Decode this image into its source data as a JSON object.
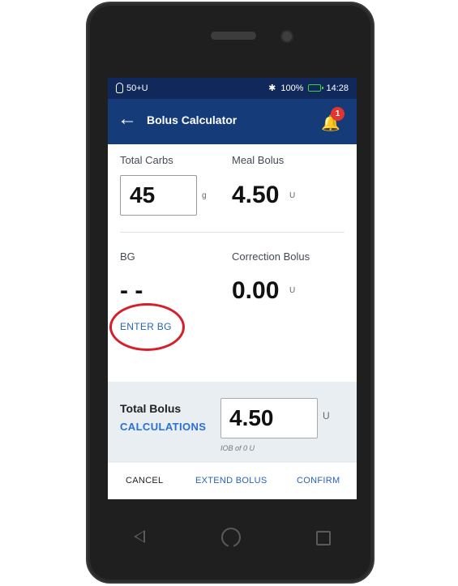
{
  "status_bar": {
    "insulin_reading": "50+U",
    "battery_percent": "100%",
    "time": "14:28"
  },
  "app_bar": {
    "title": "Bolus Calculator",
    "notification_count": "1"
  },
  "carbs": {
    "label": "Total Carbs",
    "value": "45",
    "unit": "g"
  },
  "meal_bolus": {
    "label": "Meal Bolus",
    "value": "4.50",
    "unit": "U"
  },
  "bg": {
    "label": "BG",
    "value": "- -",
    "enter_label": "ENTER BG"
  },
  "correction_bolus": {
    "label": "Correction Bolus",
    "value": "0.00",
    "unit": "U"
  },
  "total_bolus": {
    "label": "Total Bolus",
    "calculations_label": "CALCULATIONS",
    "value": "4.50",
    "unit": "U",
    "iob_note": "IOB of 0 U"
  },
  "actions": {
    "cancel": "CANCEL",
    "extend": "EXTEND BOLUS",
    "confirm": "CONFIRM"
  },
  "colors": {
    "status_bar": "#10285a",
    "app_bar": "#153b79",
    "link_blue": "#2763b8",
    "highlight_ring": "#d61f2a",
    "badge": "#e3342f"
  }
}
